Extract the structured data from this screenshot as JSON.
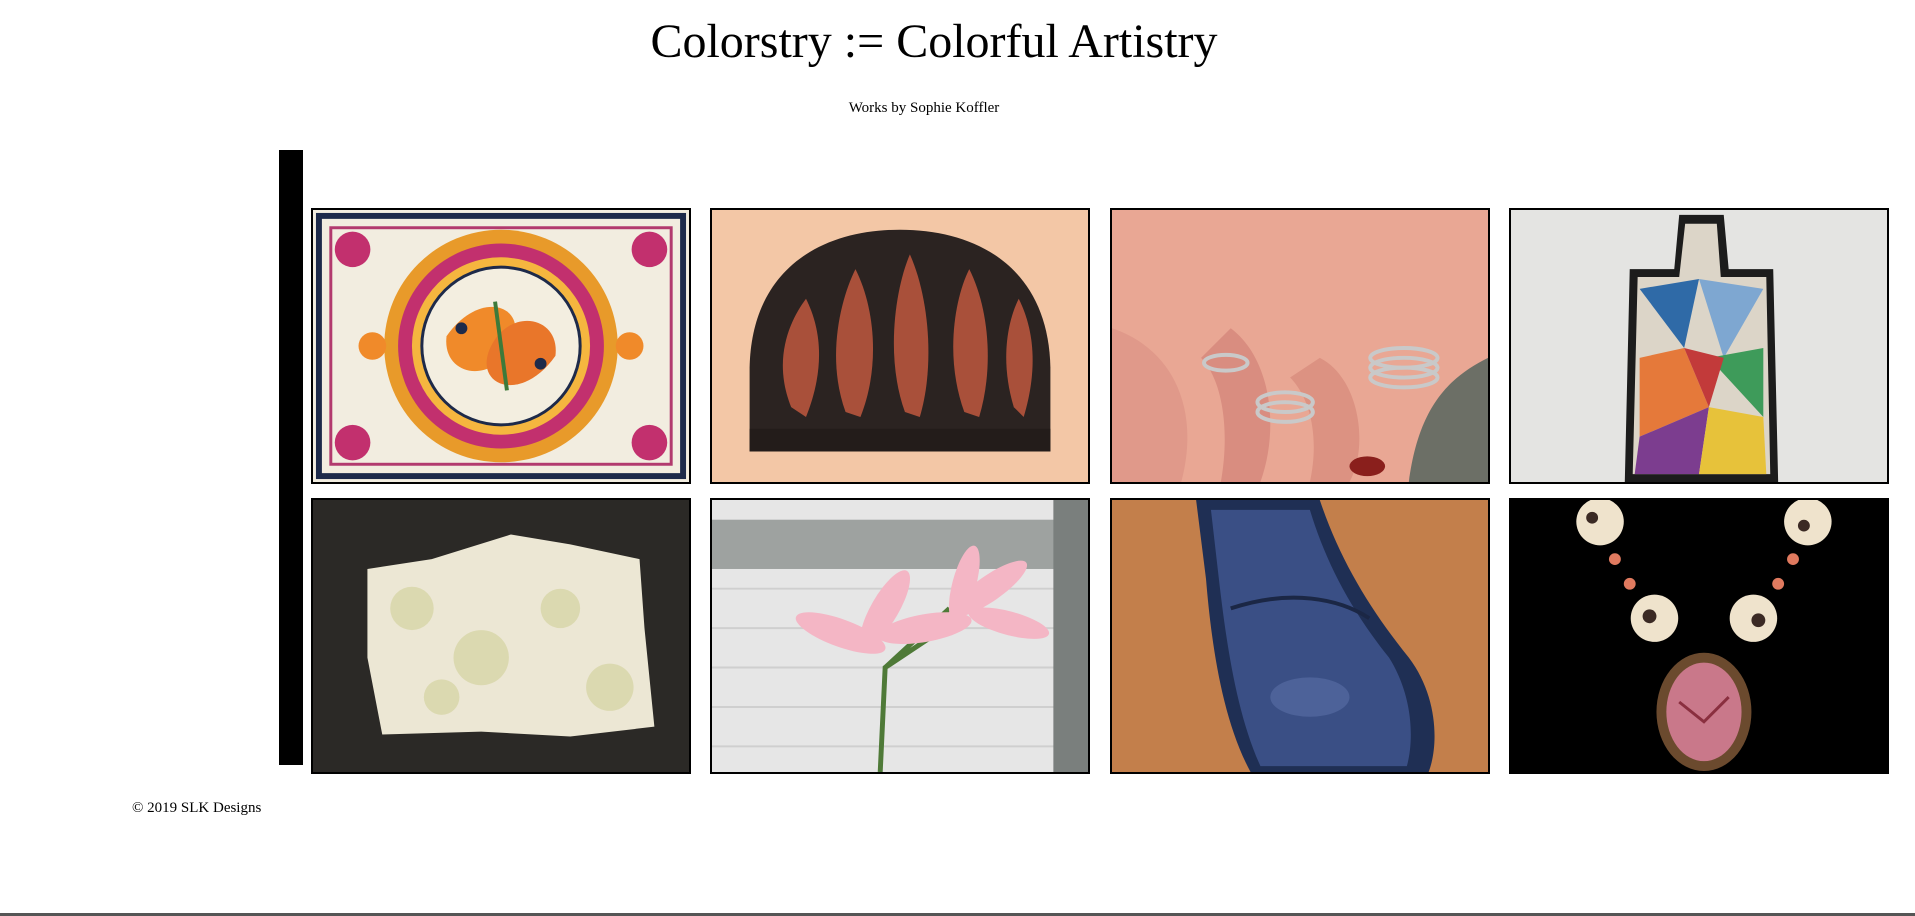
{
  "header": {
    "title": "Colorstry := Colorful Artistry",
    "subtitle": "Works by Sophie Koffler"
  },
  "gallery": {
    "items": [
      {
        "icon": "mandala-coloring-icon"
      },
      {
        "icon": "knit-hat-icon"
      },
      {
        "icon": "rings-hand-icon"
      },
      {
        "icon": "mosaic-board-icon"
      },
      {
        "icon": "handmade-paper-icon"
      },
      {
        "icon": "lily-flower-icon"
      },
      {
        "icon": "blue-ceramic-dish-icon"
      },
      {
        "icon": "beaded-necklace-icon"
      }
    ]
  },
  "footer": {
    "copyright": "© 2019 SLK Designs"
  }
}
